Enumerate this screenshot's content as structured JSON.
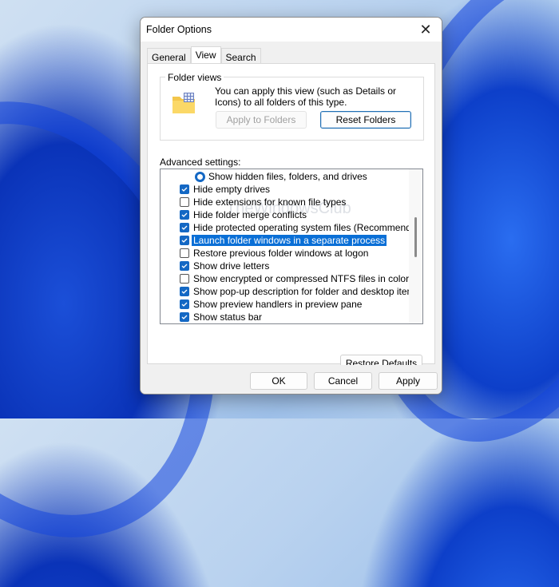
{
  "window": {
    "title": "Folder Options",
    "close_icon": "close-icon"
  },
  "tabs": [
    {
      "label": "General",
      "active": false
    },
    {
      "label": "View",
      "active": true
    },
    {
      "label": "Search",
      "active": false
    }
  ],
  "folder_views": {
    "label": "Folder views",
    "icon": "folder-grid-icon",
    "description": "You can apply this view (such as Details or Icons) to all folders of this type.",
    "apply_label": "Apply to Folders",
    "apply_enabled": false,
    "reset_label": "Reset Folders"
  },
  "advanced": {
    "label": "Advanced settings:",
    "items": [
      {
        "type": "radio",
        "label": "Show hidden files, folders, and drives",
        "checked": false
      },
      {
        "type": "checkbox",
        "label": "Hide empty drives",
        "checked": true
      },
      {
        "type": "checkbox",
        "label": "Hide extensions for known file types",
        "checked": false
      },
      {
        "type": "checkbox",
        "label": "Hide folder merge conflicts",
        "checked": true
      },
      {
        "type": "checkbox",
        "label": "Hide protected operating system files (Recommended)",
        "checked": true
      },
      {
        "type": "checkbox",
        "label": "Launch folder windows in a separate process",
        "checked": true,
        "selected": true
      },
      {
        "type": "checkbox",
        "label": "Restore previous folder windows at logon",
        "checked": false
      },
      {
        "type": "checkbox",
        "label": "Show drive letters",
        "checked": true
      },
      {
        "type": "checkbox",
        "label": "Show encrypted or compressed NTFS files in color",
        "checked": false
      },
      {
        "type": "checkbox",
        "label": "Show pop-up description for folder and desktop items",
        "checked": true
      },
      {
        "type": "checkbox",
        "label": "Show preview handlers in preview pane",
        "checked": true
      },
      {
        "type": "checkbox",
        "label": "Show status bar",
        "checked": true
      }
    ],
    "restore_label": "Restore Defaults"
  },
  "watermark": "TheWindowsClub",
  "footer": {
    "ok": "OK",
    "cancel": "Cancel",
    "apply": "Apply"
  },
  "colors": {
    "accent": "#1468c4",
    "selection": "#0a6fd6"
  }
}
